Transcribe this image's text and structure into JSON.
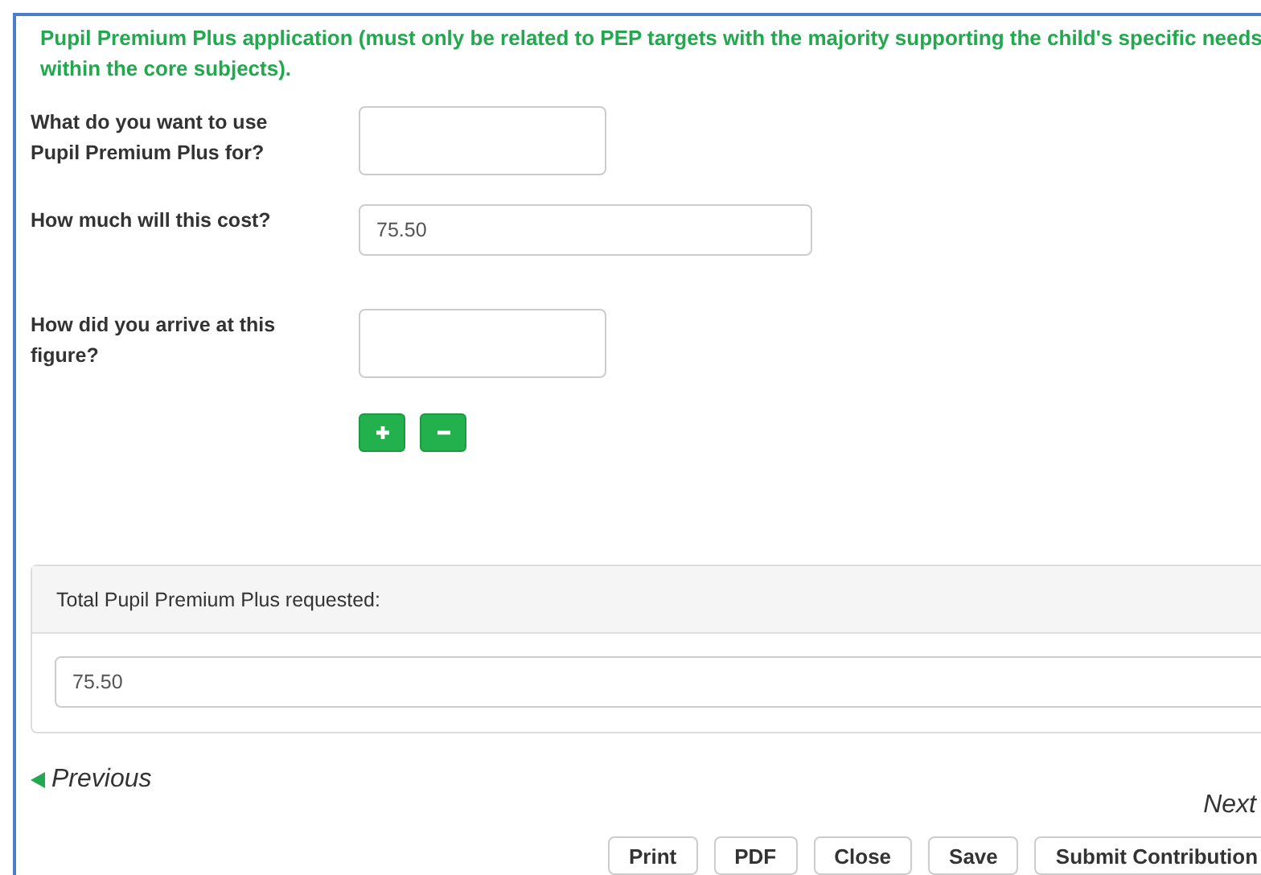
{
  "heading": "Pupil Premium Plus application (must only be related to PEP targets with the majority supporting the child's specific needs within the core subjects).",
  "fields": [
    {
      "label": "What do you want to use Pupil Premium Plus for?",
      "kind": "short"
    },
    {
      "label": "How much will this cost?",
      "kind": "long",
      "value": "75.50"
    },
    {
      "label": "How did you arrive at this figure?",
      "kind": "short"
    }
  ],
  "total": {
    "label": "Total Pupil Premium Plus requested:",
    "value": "75.50"
  },
  "previous": "Previous",
  "next": "Next",
  "actions": [
    "Print",
    "PDF",
    "Close",
    "Save",
    "Submit Contribution"
  ]
}
